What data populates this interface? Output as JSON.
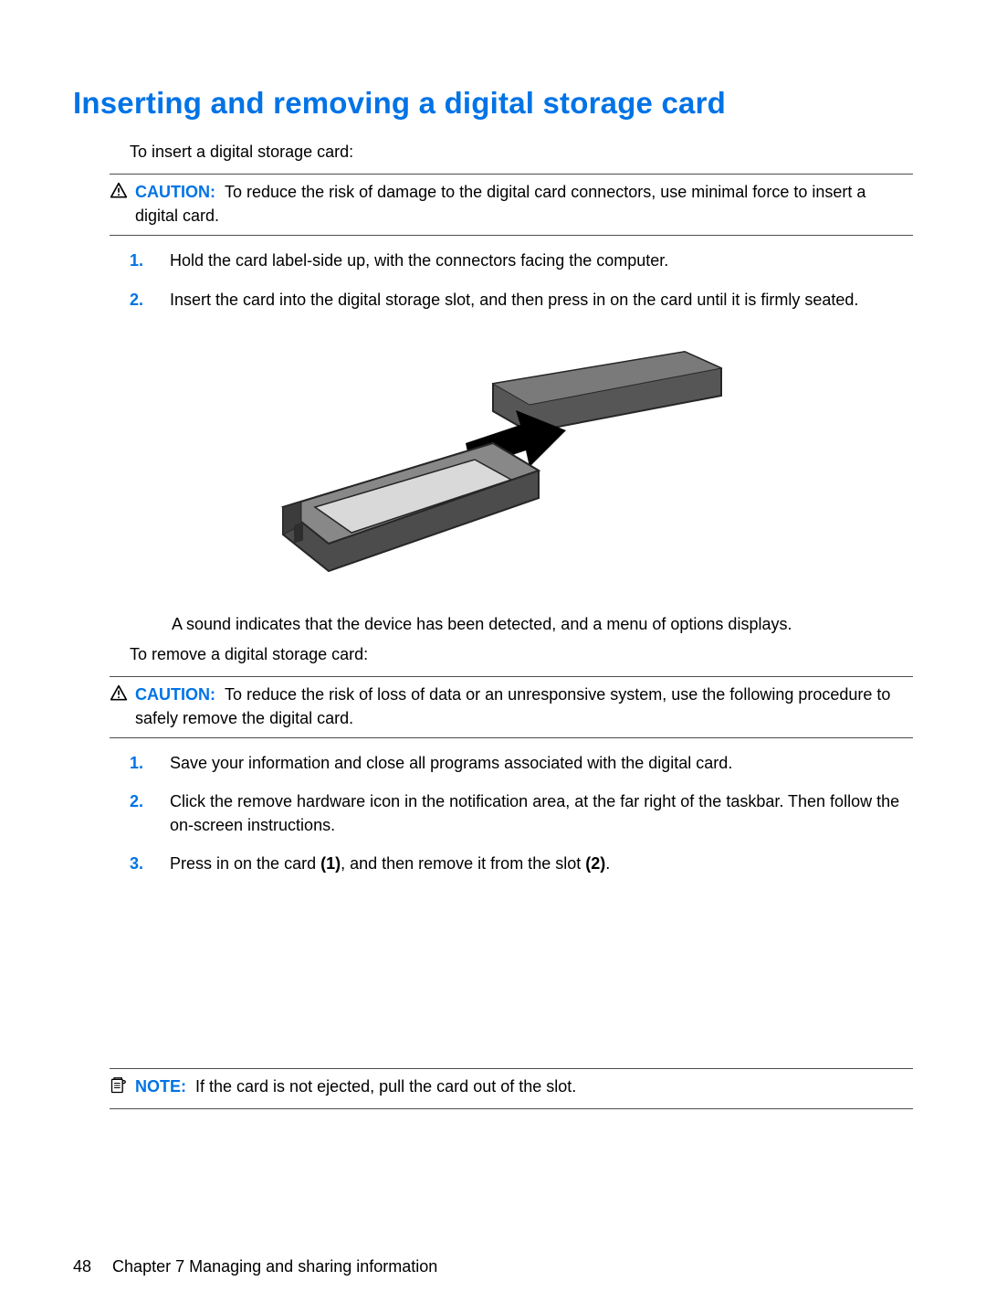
{
  "heading": "Inserting and removing a digital storage card",
  "intro_insert": "To insert a digital storage card:",
  "caution1": {
    "label": "CAUTION:",
    "text": "To reduce the risk of damage to the digital card connectors, use minimal force to insert a digital card."
  },
  "insert_steps": {
    "n1": "1.",
    "t1": "Hold the card label-side up, with the connectors facing the computer.",
    "n2": "2.",
    "t2": "Insert the card into the digital storage slot, and then press in on the card until it is firmly seated."
  },
  "followup_sound": "A sound indicates that the device has been detected, and a menu of options displays.",
  "intro_remove": "To remove a digital storage card:",
  "caution2": {
    "label": "CAUTION:",
    "text": "To reduce the risk of loss of data or an unresponsive system, use the following procedure to safely remove the digital card."
  },
  "remove_steps": {
    "n1": "1.",
    "t1": "Save your information and close all programs associated with the digital card.",
    "n2": "2.",
    "t2": "Click the remove hardware icon in the notification area, at the far right of the taskbar. Then follow the on-screen instructions.",
    "n3": "3.",
    "t3a": "Press in on the card ",
    "t3b1": "(1)",
    "t3c": ", and then remove it from the slot ",
    "t3b2": "(2)",
    "t3d": "."
  },
  "note": {
    "label": "NOTE:",
    "text": "If the card is not ejected, pull the card out of the slot."
  },
  "footer": {
    "pagenum": "48",
    "chapter": "Chapter 7   Managing and sharing information"
  }
}
